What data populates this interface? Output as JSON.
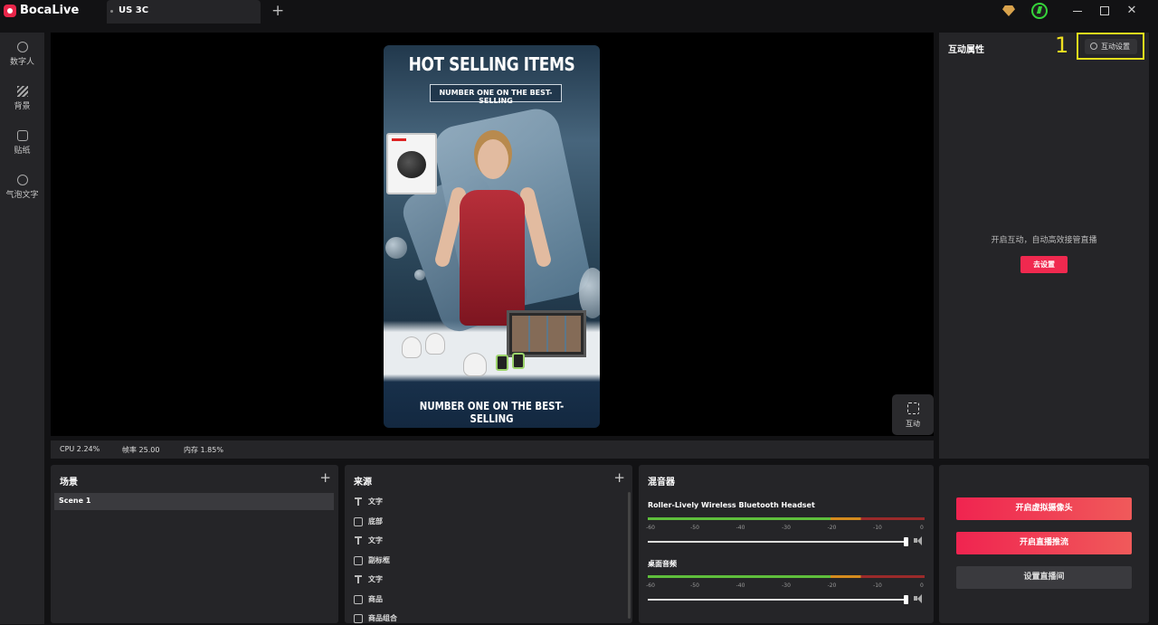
{
  "app": {
    "name": "BocaLive",
    "tab": "US 3C",
    "new_tab": "+"
  },
  "sidebar": {
    "items": [
      {
        "label": "数字人",
        "icon": "person-icon"
      },
      {
        "label": "背景",
        "icon": "background-icon"
      },
      {
        "label": "贴纸",
        "icon": "sticker-icon"
      },
      {
        "label": "气泡文字",
        "icon": "bubble-text-icon"
      }
    ]
  },
  "canvas": {
    "title": "HOT SELLING ITEMS",
    "subtitle": "NUMBER ONE ON THE BEST-SELLING",
    "bottom_text": "NUMBER ONE ON THE BEST-SELLING"
  },
  "interact_button": {
    "label": "互动"
  },
  "status": {
    "cpu": "CPU 2.24%",
    "fps": "帧率 25.00",
    "memory": "内存 1.85%"
  },
  "right_panel": {
    "title": "互动属性",
    "annotation": "1",
    "settings_button": "互动设置",
    "message": "开启互动，自动高效接管直播",
    "go_button": "去设置"
  },
  "scenes": {
    "title": "场景",
    "add": "+",
    "items": [
      "Scene 1"
    ]
  },
  "sources": {
    "title": "来源",
    "add": "+",
    "items": [
      {
        "label": "文字",
        "icon": "text-icon"
      },
      {
        "label": "底部",
        "icon": "image-icon"
      },
      {
        "label": "文字",
        "icon": "text-icon"
      },
      {
        "label": "副标框",
        "icon": "image-icon"
      },
      {
        "label": "文字",
        "icon": "text-icon"
      },
      {
        "label": "商品",
        "icon": "image-icon"
      },
      {
        "label": "商品组合",
        "icon": "image-icon"
      }
    ]
  },
  "mixer": {
    "title": "混音器",
    "ticks": [
      "-60",
      "-50",
      "-40",
      "-30",
      "-20",
      "-10",
      "0"
    ],
    "channels": [
      {
        "name": "Roller-Lively Wireless Bluetooth Headset",
        "volume": 1.0
      },
      {
        "name": "桌面音频",
        "volume": 1.0
      }
    ]
  },
  "actions": {
    "virtual_camera": "开启虚拟摄像头",
    "start_stream": "开启直播推流",
    "room_settings": "设置直播间"
  },
  "colors": {
    "accent": "#f0294f",
    "highlight": "#e4e01c",
    "panel": "#252528"
  }
}
